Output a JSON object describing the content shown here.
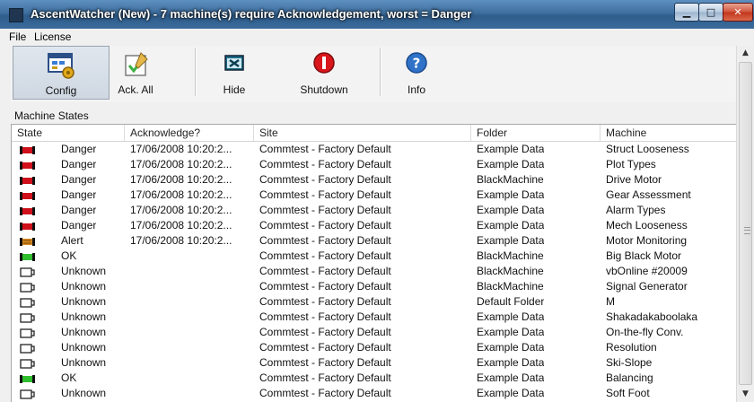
{
  "window": {
    "title": "AscentWatcher (New) - 7 machine(s) require Acknowledgement, worst = Danger"
  },
  "menu": [
    "File",
    "License"
  ],
  "toolbar": {
    "buttons": [
      {
        "label": "Config",
        "icon": "config-icon"
      },
      {
        "label": "Ack. All",
        "icon": "acknowledge-check-icon"
      },
      {
        "label": "Hide",
        "icon": "hide-icon"
      },
      {
        "label": "Shutdown",
        "icon": "shutdown-icon"
      },
      {
        "label": "Info",
        "icon": "info-icon"
      }
    ]
  },
  "section_label": "Machine States",
  "table": {
    "columns": [
      "State",
      "Acknowledge?",
      "Site",
      "Folder",
      "Machine"
    ],
    "rows": [
      {
        "state": "Danger",
        "ack": "17/06/2008 10:20:2...",
        "site": "Commtest - Factory Default",
        "folder": "Example Data",
        "machine": "Struct Looseness"
      },
      {
        "state": "Danger",
        "ack": "17/06/2008 10:20:2...",
        "site": "Commtest - Factory Default",
        "folder": "Example Data",
        "machine": "Plot Types"
      },
      {
        "state": "Danger",
        "ack": "17/06/2008 10:20:2...",
        "site": "Commtest - Factory Default",
        "folder": "BlackMachine",
        "machine": "Drive Motor"
      },
      {
        "state": "Danger",
        "ack": "17/06/2008 10:20:2...",
        "site": "Commtest - Factory Default",
        "folder": "Example Data",
        "machine": "Gear Assessment"
      },
      {
        "state": "Danger",
        "ack": "17/06/2008 10:20:2...",
        "site": "Commtest - Factory Default",
        "folder": "Example Data",
        "machine": "Alarm Types"
      },
      {
        "state": "Danger",
        "ack": "17/06/2008 10:20:2...",
        "site": "Commtest - Factory Default",
        "folder": "Example Data",
        "machine": "Mech Looseness"
      },
      {
        "state": "Alert",
        "ack": "17/06/2008 10:20:2...",
        "site": "Commtest - Factory Default",
        "folder": "Example Data",
        "machine": "Motor Monitoring"
      },
      {
        "state": "OK",
        "ack": "",
        "site": "Commtest - Factory Default",
        "folder": "BlackMachine",
        "machine": "Big Black Motor"
      },
      {
        "state": "Unknown",
        "ack": "",
        "site": "Commtest - Factory Default",
        "folder": "BlackMachine",
        "machine": "vbOnline #20009"
      },
      {
        "state": "Unknown",
        "ack": "",
        "site": "Commtest - Factory Default",
        "folder": "BlackMachine",
        "machine": "Signal Generator"
      },
      {
        "state": "Unknown",
        "ack": "",
        "site": "Commtest - Factory Default",
        "folder": "Default Folder",
        "machine": "M"
      },
      {
        "state": "Unknown",
        "ack": "",
        "site": "Commtest - Factory Default",
        "folder": "Example Data",
        "machine": "Shakadakaboolaka"
      },
      {
        "state": "Unknown",
        "ack": "",
        "site": "Commtest - Factory Default",
        "folder": "Example Data",
        "machine": "On-the-fly Conv."
      },
      {
        "state": "Unknown",
        "ack": "",
        "site": "Commtest - Factory Default",
        "folder": "Example Data",
        "machine": "Resolution"
      },
      {
        "state": "Unknown",
        "ack": "",
        "site": "Commtest - Factory Default",
        "folder": "Example Data",
        "machine": "Ski-Slope"
      },
      {
        "state": "OK",
        "ack": "",
        "site": "Commtest - Factory Default",
        "folder": "Example Data",
        "machine": "Balancing"
      },
      {
        "state": "Unknown",
        "ack": "",
        "site": "Commtest - Factory Default",
        "folder": "Example Data",
        "machine": "Soft Foot"
      }
    ]
  },
  "state_colors": {
    "Danger": "#d0101a",
    "Alert": "#d98a1f",
    "OK": "#2fbf2f",
    "Unknown": "#ffffff"
  }
}
